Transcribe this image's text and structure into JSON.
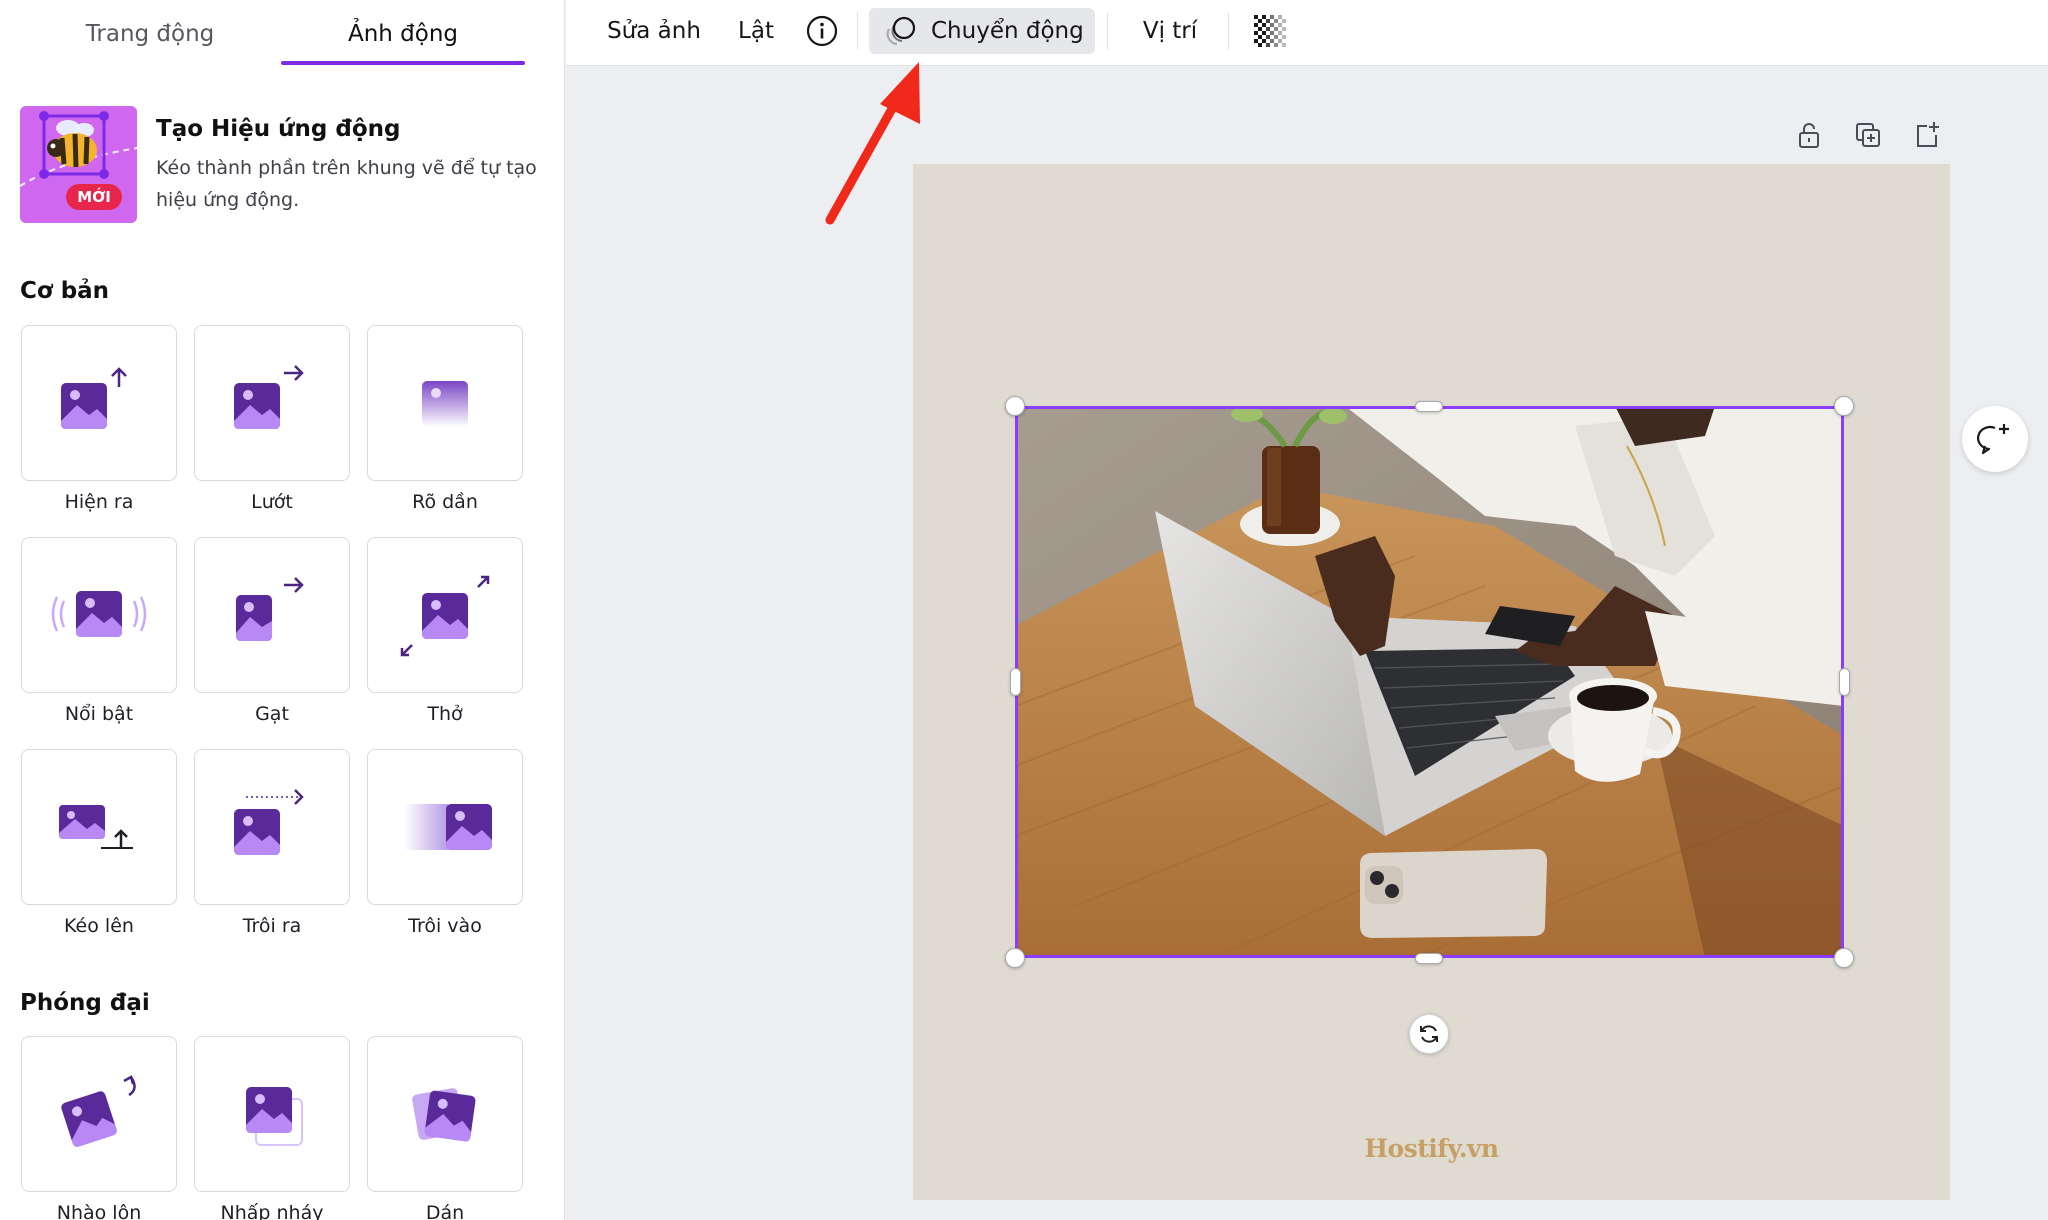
{
  "tabs": [
    {
      "label": "Trang động"
    },
    {
      "label": "Ảnh động",
      "active": true
    }
  ],
  "promo": {
    "title": "Tạo Hiệu ứng động",
    "description": "Kéo thành phần trên khung vẽ để tự tạo hiệu ứng động.",
    "badge": "MỚI"
  },
  "sections": {
    "basic": {
      "title": "Cơ bản",
      "items": [
        "Hiện ra",
        "Lướt",
        "Rõ dần",
        "Nổi bật",
        "Gạt",
        "Thở",
        "Kéo lên",
        "Trôi ra",
        "Trôi vào"
      ]
    },
    "exaggerated": {
      "title": "Phóng đại",
      "items": [
        "Nhào lộn",
        "Nhấp nháy",
        "Dán"
      ]
    }
  },
  "toolbar": {
    "edit_photo": "Sửa ảnh",
    "flip": "Lật",
    "info_icon": "info-icon",
    "animate": "Chuyển động",
    "position": "Vị trí",
    "transparency_icon": "checkerboard-icon"
  },
  "canvas": {
    "watermark": "Hostify.vn",
    "page_actions": [
      "lock-icon",
      "duplicate-icon",
      "add-page-icon"
    ]
  },
  "colors": {
    "accent": "#7d2ae8",
    "selection": "#8b3dff",
    "annotation_arrow": "#f0291a",
    "page_bg": "#dfdbd1",
    "brand_text": "#c7a067"
  }
}
